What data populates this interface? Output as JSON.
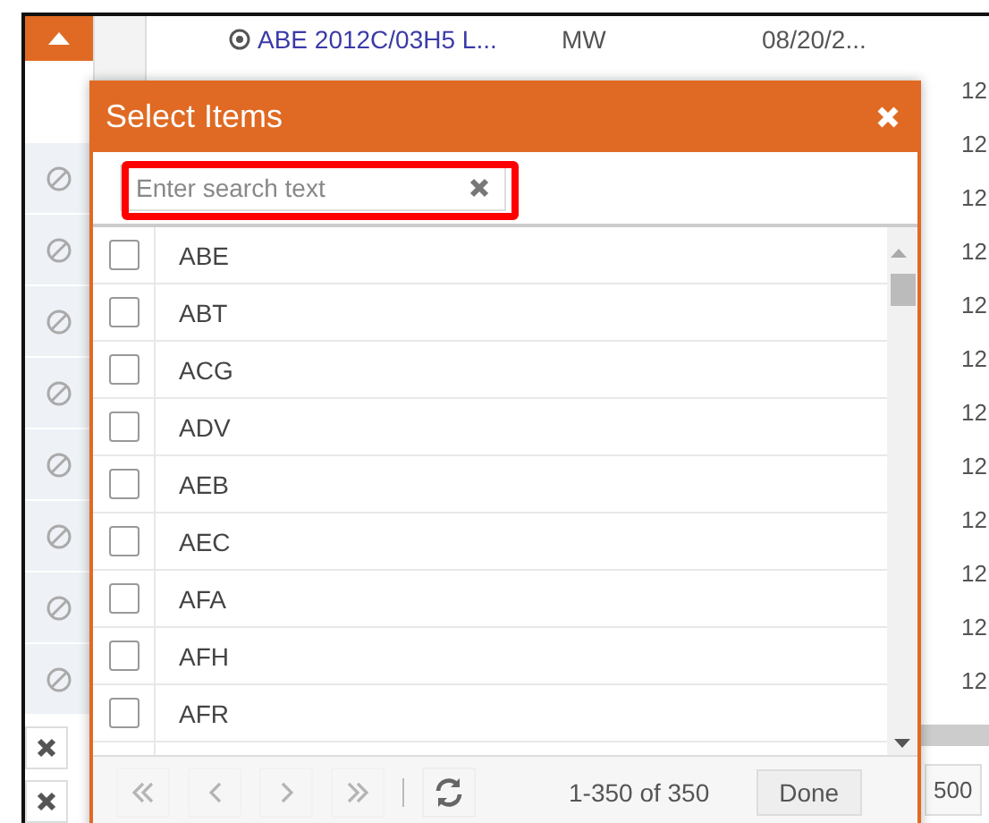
{
  "table": {
    "rows": [
      {
        "name": "ABE 2012C/03H5 L...",
        "code": "MW",
        "date": "08/20/2..."
      }
    ],
    "column_4": [
      "12",
      "12",
      "12",
      "12",
      "12",
      "12",
      "12",
      "12",
      "12",
      "12",
      "12",
      "12"
    ],
    "page_size": "500"
  },
  "dialog": {
    "title": "Select Items",
    "search": {
      "placeholder": "Enter search text"
    },
    "items": [
      {
        "label": "ABE",
        "checked": false
      },
      {
        "label": "ABT",
        "checked": false
      },
      {
        "label": "ACG",
        "checked": false
      },
      {
        "label": "ADV",
        "checked": false
      },
      {
        "label": "AEB",
        "checked": false
      },
      {
        "label": "AEC",
        "checked": false
      },
      {
        "label": "AFA",
        "checked": false
      },
      {
        "label": "AFH",
        "checked": false
      },
      {
        "label": "AFR",
        "checked": false
      }
    ],
    "pager": [
      {
        "kind": "first",
        "disabled": true
      },
      {
        "kind": "prev",
        "disabled": true
      },
      {
        "kind": "next",
        "disabled": true
      },
      {
        "kind": "last",
        "disabled": true
      }
    ],
    "range": "1-350 of 350",
    "done": "Done"
  }
}
